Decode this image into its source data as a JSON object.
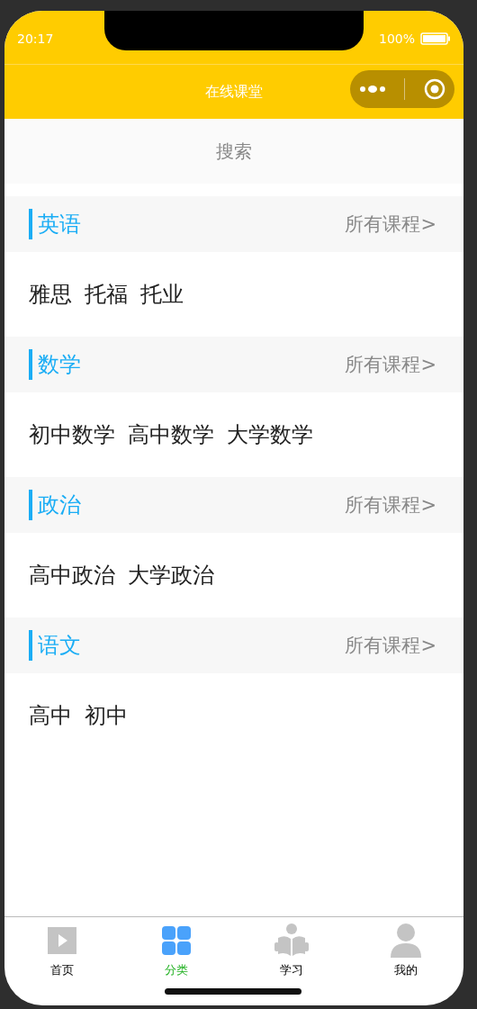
{
  "status_bar": {
    "time": "20:17",
    "battery": "100%"
  },
  "nav": {
    "title": "在线课堂"
  },
  "search": {
    "placeholder": "搜索"
  },
  "categories": [
    {
      "title": "英语",
      "link": "所有课程>",
      "items": [
        "雅思",
        "托福",
        "托业"
      ]
    },
    {
      "title": "数学",
      "link": "所有课程>",
      "items": [
        "初中数学",
        "高中数学",
        "大学数学"
      ]
    },
    {
      "title": "政治",
      "link": "所有课程>",
      "items": [
        "高中政治",
        "大学政治"
      ]
    },
    {
      "title": "语文",
      "link": "所有课程>",
      "items": [
        "高中",
        "初中"
      ]
    }
  ],
  "tab_bar": [
    {
      "kind": "play",
      "label": "首页",
      "selected": false
    },
    {
      "kind": "grid",
      "label": "分类",
      "selected": true
    },
    {
      "kind": "reader",
      "label": "学习",
      "selected": false
    },
    {
      "kind": "person",
      "label": "我的",
      "selected": false
    }
  ]
}
